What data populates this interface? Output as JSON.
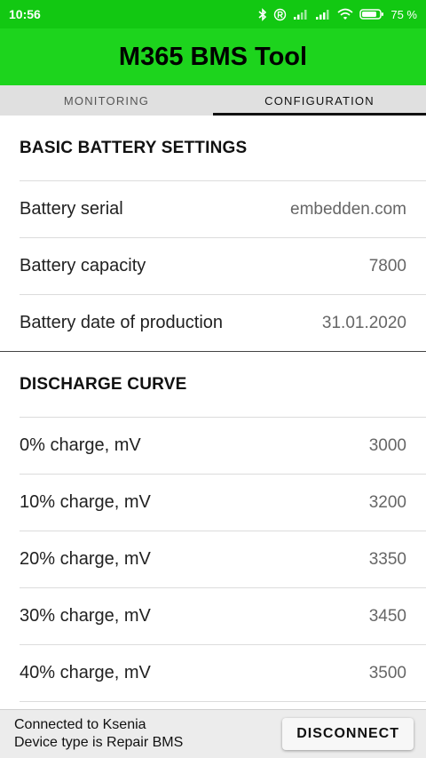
{
  "status_bar": {
    "time": "10:56",
    "battery_percent": "75 %"
  },
  "app": {
    "title": "M365 BMS Tool"
  },
  "tabs": [
    {
      "label": "MONITORING",
      "active": false
    },
    {
      "label": "CONFIGURATION",
      "active": true
    }
  ],
  "basic": {
    "header": "BASIC BATTERY SETTINGS",
    "rows": [
      {
        "label": "Battery serial",
        "value": "embedden.com"
      },
      {
        "label": "Battery capacity",
        "value": "7800"
      },
      {
        "label": "Battery date of production",
        "value": "31.01.2020"
      }
    ]
  },
  "discharge": {
    "header": "DISCHARGE CURVE",
    "rows": [
      {
        "label": "0% charge, mV",
        "value": "3000"
      },
      {
        "label": "10% charge, mV",
        "value": "3200"
      },
      {
        "label": "20% charge, mV",
        "value": "3350"
      },
      {
        "label": "30% charge, mV",
        "value": "3450"
      },
      {
        "label": "40% charge, mV",
        "value": "3500"
      }
    ]
  },
  "connection": {
    "line1": "Connected to Ksenia",
    "line2": "Device type is Repair BMS",
    "disconnect_label": "DISCONNECT"
  }
}
